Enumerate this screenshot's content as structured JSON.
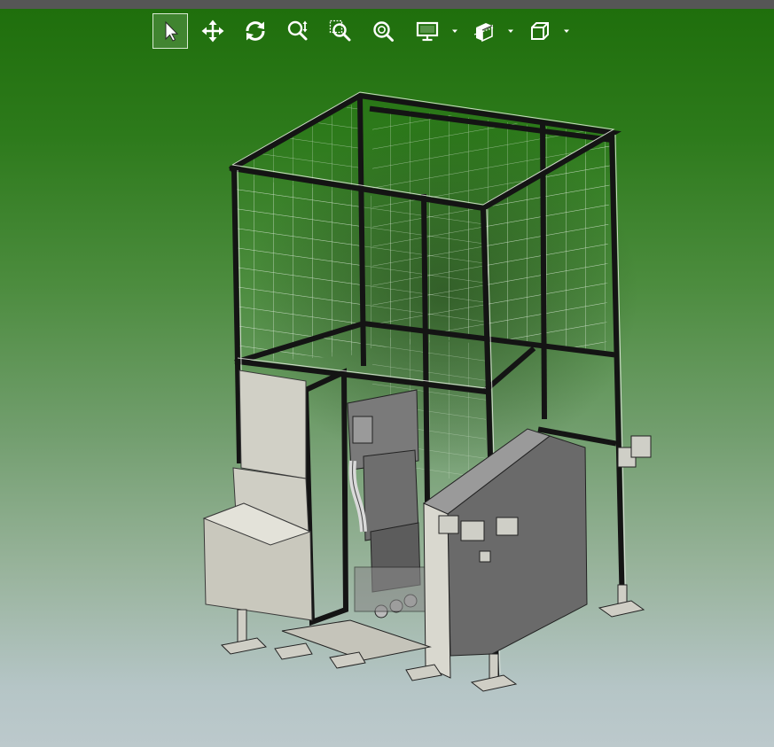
{
  "window": {
    "background_top": "#1e6e0b",
    "background_bottom": "#bcc9cc",
    "top_strip_color": "#565656"
  },
  "toolbar": {
    "icon_color": "#ffffff",
    "tools": [
      {
        "id": "select",
        "icon": "arrow-pointer-icon",
        "active": true
      },
      {
        "id": "pan",
        "icon": "move-arrows-icon",
        "active": false
      },
      {
        "id": "rotate",
        "icon": "rotate-arrows-icon",
        "active": false
      },
      {
        "id": "zoom",
        "icon": "zoom-updown-icon",
        "active": false
      },
      {
        "id": "zoom-window",
        "icon": "zoom-window-icon",
        "active": false
      },
      {
        "id": "zoom-fit",
        "icon": "zoom-fit-icon",
        "active": false
      },
      {
        "id": "display",
        "icon": "monitor-icon",
        "has_dropdown": true
      },
      {
        "id": "section",
        "icon": "section-cube-icon",
        "has_dropdown": true
      },
      {
        "id": "views",
        "icon": "view-cube-icon",
        "has_dropdown": true
      }
    ]
  },
  "model": {
    "description_icon": "machine-enclosure-model",
    "frame_color": "#1a1a1a",
    "panel_color": "#c8c6bb",
    "dark_panel_color": "#6a6a6a"
  }
}
